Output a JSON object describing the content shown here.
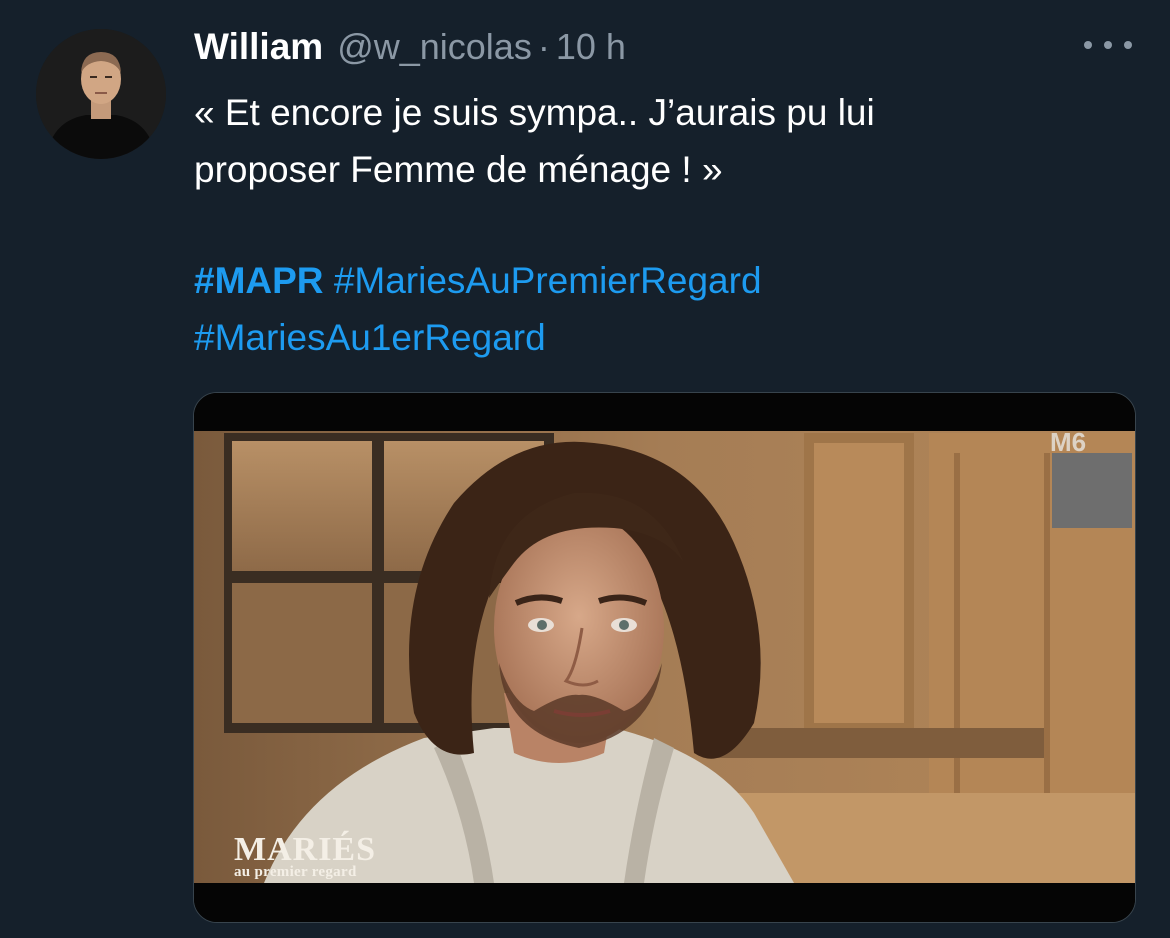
{
  "tweet": {
    "author_name": "William",
    "handle": "@w_nicolas",
    "separator": "·",
    "time": "10 h",
    "text_line1": "« Et encore je suis sympa.. J’aurais pu lui",
    "text_line2": "proposer Femme de ménage ! »",
    "hashtags": {
      "tag1": "#MAPR",
      "tag2": "#MariesAuPremierRegard",
      "tag3": "#MariesAu1erRegard"
    },
    "more_icon": "more-horizontal-icon",
    "avatar_icon": "profile-avatar"
  },
  "media": {
    "show_title": "MARIÉS",
    "show_subtitle": "au premier regard",
    "channel_logo": "M6"
  },
  "colors": {
    "background": "#15202b",
    "text_primary": "#ffffff",
    "text_secondary": "#8b98a5",
    "link": "#1d9bf0"
  }
}
